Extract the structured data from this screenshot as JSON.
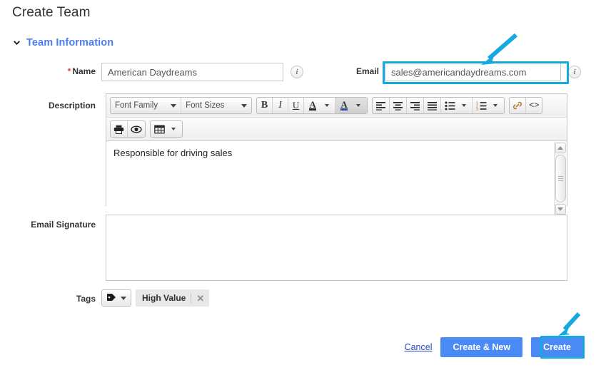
{
  "page": {
    "title": "Create Team"
  },
  "section": {
    "title": "Team Information",
    "chevron_icon": "chevron-down-icon"
  },
  "fields": {
    "name": {
      "label": "Name",
      "required_marker": "*",
      "value": "American Daydreams",
      "info_icon": "i"
    },
    "email": {
      "label": "Email",
      "value": "sales@americandaydreams.com",
      "info_icon": "i",
      "highlighted": "true"
    },
    "description": {
      "label": "Description",
      "value": "Responsible for driving sales"
    },
    "email_signature": {
      "label": "Email Signature",
      "value": ""
    },
    "tags": {
      "label": "Tags",
      "tag_icon": "tag-icon",
      "chips": [
        {
          "label": "High Value",
          "remove_icon": "✕"
        }
      ]
    }
  },
  "editor_toolbar": {
    "row1": {
      "font_family": {
        "label": "Font Family",
        "icon": "chevron-down-icon"
      },
      "font_sizes": {
        "label": "Font Sizes",
        "icon": "chevron-down-icon"
      },
      "bold": "B",
      "italic": "I",
      "underline": "U",
      "text_color": "A",
      "background_color": "A",
      "align_left": "align-left-icon",
      "align_center": "align-center-icon",
      "align_right": "align-right-icon",
      "align_justify": "align-justify-icon",
      "bullet_list": "bullet-list-icon",
      "numbered_list": "numbered-list-icon",
      "link": "🔗",
      "source_code": "<>"
    },
    "row2": {
      "print": "print-icon",
      "preview": "eye-icon",
      "table": "table-icon"
    }
  },
  "footer": {
    "cancel_label": "Cancel",
    "create_and_new_label": "Create & New",
    "create_label": "Create"
  },
  "annotations": {
    "arrow_email": "arrow-pointing-to-email-field",
    "arrow_create": "arrow-pointing-to-create-button",
    "accent_color": "#17a8e0",
    "primary_button_color": "#4a8af4",
    "section_title_color": "#4a7ef0"
  }
}
